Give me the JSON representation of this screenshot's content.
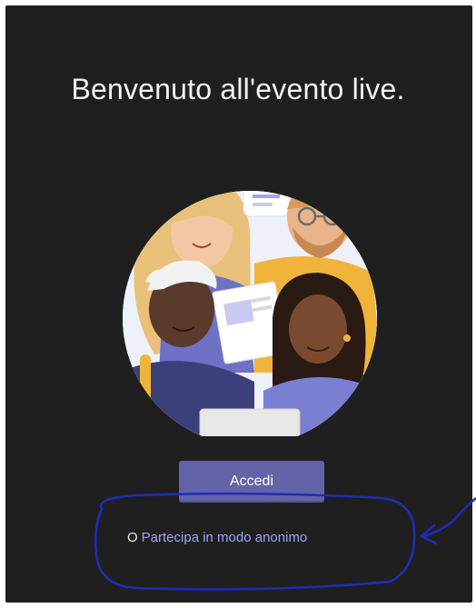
{
  "welcome": {
    "title": "Benvenuto all'evento live."
  },
  "illustration": {
    "icon": "people-group-illustration",
    "colors": {
      "circle": "#f4f4f4",
      "accent_purple": "#6264a7",
      "skin_dark": "#5a3a2a",
      "skin_light": "#f3c7a3",
      "hair_blonde": "#e8c07a",
      "sweater_yellow": "#f1b43b"
    }
  },
  "actions": {
    "signin_label": "Accedi",
    "anon_prefix": "O",
    "anon_link_label": "Partecipa in modo anonimo"
  },
  "annotation": {
    "color": "#1d2db8"
  },
  "theme": {
    "background": "#1f1f1f",
    "button": "#6264a7",
    "link": "#9ea2ff",
    "text": "#f2f2f2"
  }
}
